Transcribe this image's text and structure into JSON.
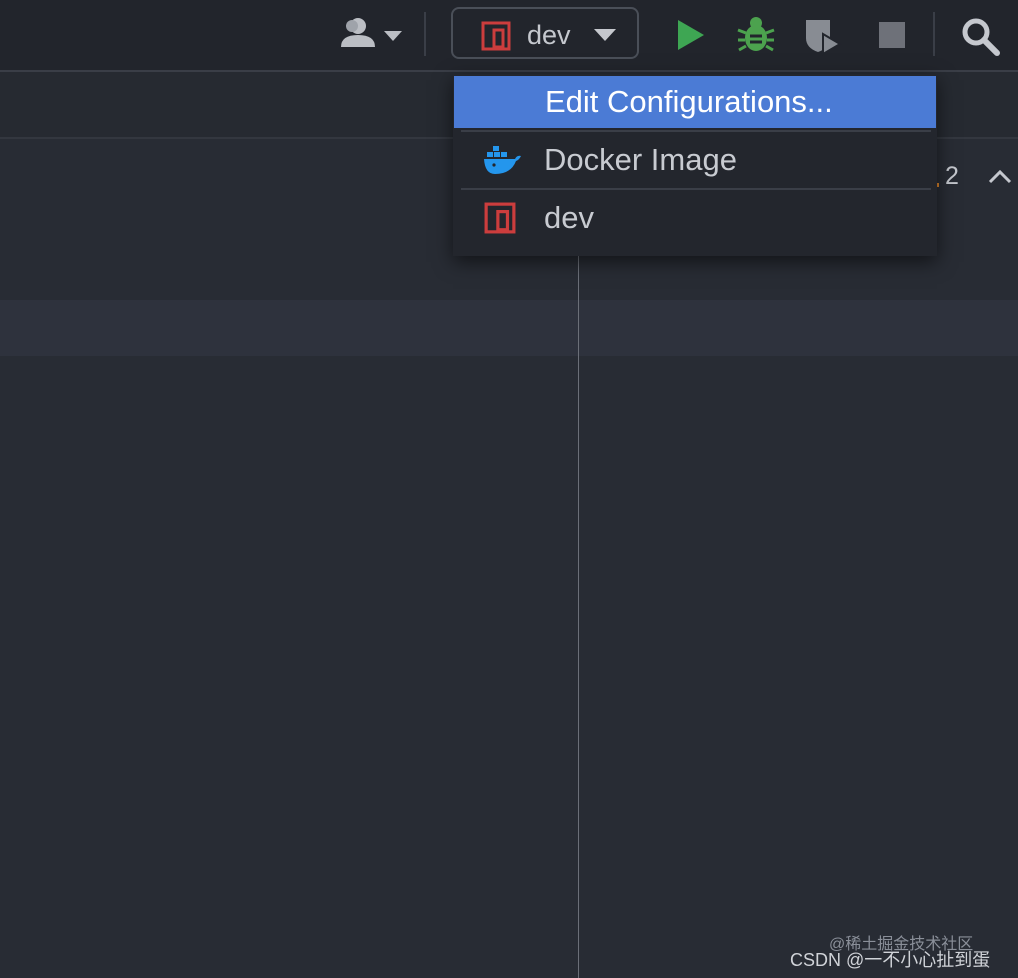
{
  "toolbar": {
    "run_config": {
      "label": "dev",
      "icon": "gradle-module-icon"
    },
    "buttons": [
      {
        "name": "user-icon"
      },
      {
        "name": "run-icon",
        "color": "#3ea653"
      },
      {
        "name": "debug-icon",
        "color": "#4ca24e"
      },
      {
        "name": "coverage-icon"
      },
      {
        "name": "stop-icon"
      },
      {
        "name": "search-icon"
      }
    ]
  },
  "dropdown": {
    "items": [
      {
        "label": "Edit Configurations...",
        "selected": true
      },
      {
        "label": "Docker Image",
        "icon": "docker-icon"
      },
      {
        "label": "dev",
        "icon": "gradle-module-icon"
      }
    ]
  },
  "editor": {
    "problem_count": "2"
  },
  "watermark": {
    "line1": "@稀土掘金技术社区",
    "line2": "CSDN @一不小心扯到蛋"
  },
  "colors": {
    "accent": "#4b7bd5",
    "run": "#3ea653",
    "module": "#cc3d3d",
    "docker": "#2496ed"
  }
}
